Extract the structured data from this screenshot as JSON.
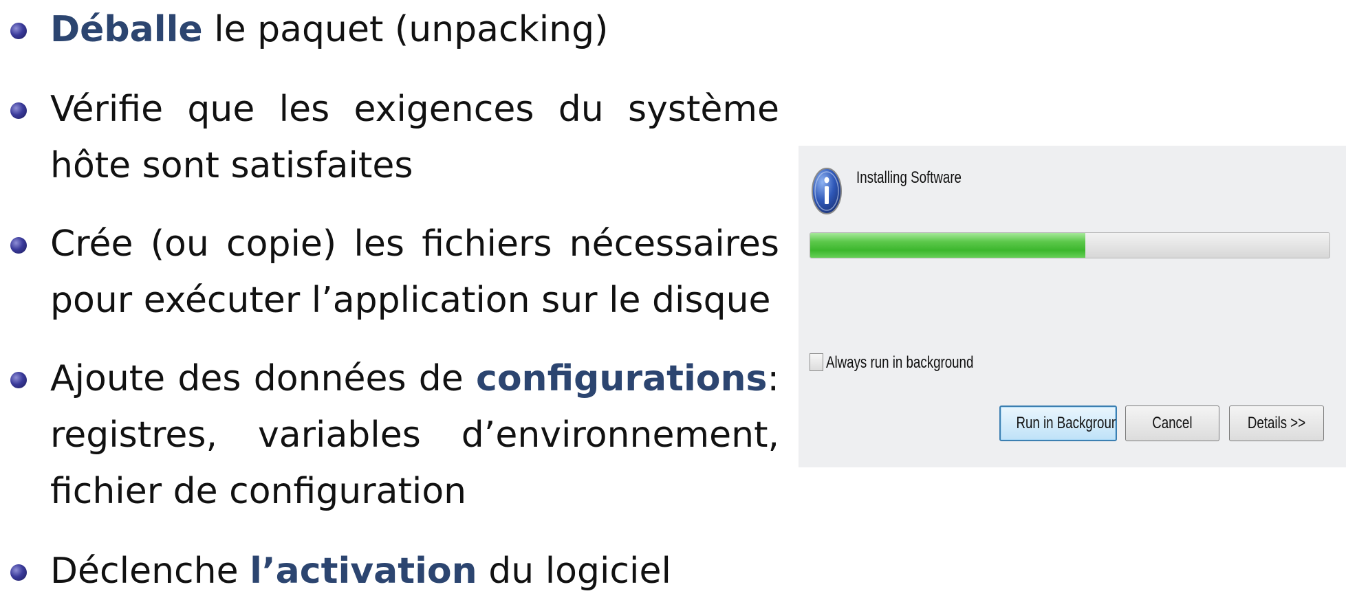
{
  "bullets": [
    {
      "pre": "",
      "hl": "Déballe",
      "post": " le paquet (unpacking)"
    },
    {
      "pre": "Vérifie que les exigences du système hôte sont satisfaites",
      "hl": "",
      "post": ""
    },
    {
      "pre": "Crée (ou copie) les fichiers nécessaires pour exécuter l’application sur le disque",
      "hl": "",
      "post": ""
    },
    {
      "pre": "Ajoute des données de ",
      "hl": "configurations",
      "post": ": registres, variables d’environnement, fichier de configuration"
    },
    {
      "pre": "Déclenche ",
      "hl": "l’activation",
      "post": " du logiciel"
    }
  ],
  "dialog": {
    "title": "Installing Software",
    "icon": "info-icon",
    "progress_fraction": 0.53,
    "checkbox_label": "Always run in background",
    "checkbox_checked": false,
    "buttons": {
      "run_background": "Run in Background",
      "cancel": "Cancel",
      "details": "Details >>"
    }
  },
  "colors": {
    "highlight": "#2c4570",
    "progress_green": "#3cb72d",
    "dialog_bg": "#eeeff1"
  }
}
